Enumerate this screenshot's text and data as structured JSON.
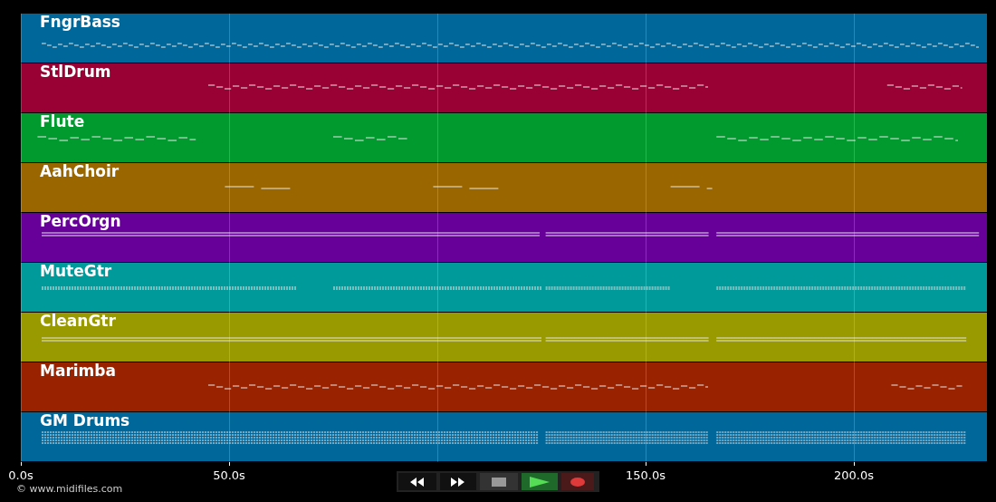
{
  "tracks": [
    {
      "name": "FngrBass",
      "color": "#00679a"
    },
    {
      "name": "StlDrum",
      "color": "#990033"
    },
    {
      "name": "Flute",
      "color": "#009a2e"
    },
    {
      "name": "AahChoir",
      "color": "#996600"
    },
    {
      "name": "PercOrgn",
      "color": "#660099"
    },
    {
      "name": "MuteGtr",
      "color": "#009a9a"
    },
    {
      "name": "CleanGtr",
      "color": "#999900"
    },
    {
      "name": "Marimba",
      "color": "#992200"
    },
    {
      "name": "GM Drums",
      "color": "#00679a"
    }
  ],
  "time_axis": {
    "ticks": [
      "0.0s",
      "50.0s",
      "150.0s",
      "200.0s"
    ]
  },
  "transport": [
    {
      "kind": "rewind"
    },
    {
      "kind": "forward"
    },
    {
      "kind": "stop"
    },
    {
      "kind": "play"
    },
    {
      "kind": "record"
    }
  ],
  "credit": "© www.midifiles.com"
}
